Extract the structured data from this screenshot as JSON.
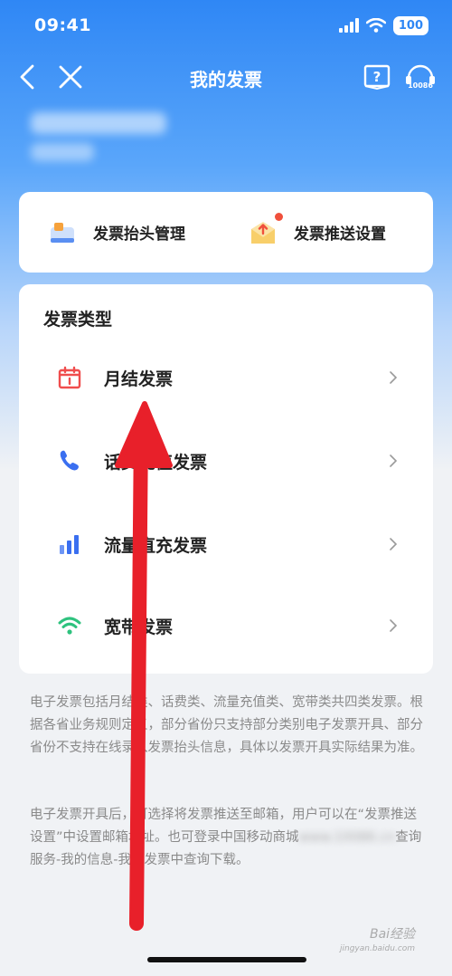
{
  "status_bar": {
    "time": "09:41",
    "battery": "100"
  },
  "nav": {
    "title": "我的发票",
    "service_number": "10086"
  },
  "quick_actions": [
    {
      "label": "发票抬头管理",
      "icon": "invoice-header-icon"
    },
    {
      "label": "发票推送设置",
      "icon": "envelope-push-icon",
      "has_badge": true
    }
  ],
  "invoice_types": {
    "title": "发票类型",
    "items": [
      {
        "label": "月结发票",
        "icon": "calendar-icon",
        "color": "#f04d4d"
      },
      {
        "label": "话费充值发票",
        "icon": "phone-icon",
        "color": "#3a6ff0"
      },
      {
        "label": "流量直充发票",
        "icon": "bar-chart-icon",
        "color": "#3a6ff0"
      },
      {
        "label": "宽带发票",
        "icon": "wifi-icon",
        "color": "#2ec27e"
      }
    ]
  },
  "notes": {
    "p1": "电子发票包括月结类、话费类、流量充值类、宽带类共四类发票。根据各省业务规则定义，部分省份只支持部分类别电子发票开具、部分省份不支持在线录入发票抬头信息，具体以发票开具实际结果为准。",
    "p2_line1": "电子发票开具后，可选择将发票推送至邮箱，用户可以在“发票推送设置”中设置邮箱地址。也可登录中国移动商城",
    "p2_blurred": "www.10086.cn",
    "p2_line2": "查询服务-我的信息-我的发票中查询下载。"
  },
  "watermark": {
    "main": "Bai经验",
    "sub": "jingyan.baidu.com"
  },
  "colors": {
    "primary_blue": "#2f87f5",
    "annotation_red": "#e8202a"
  }
}
